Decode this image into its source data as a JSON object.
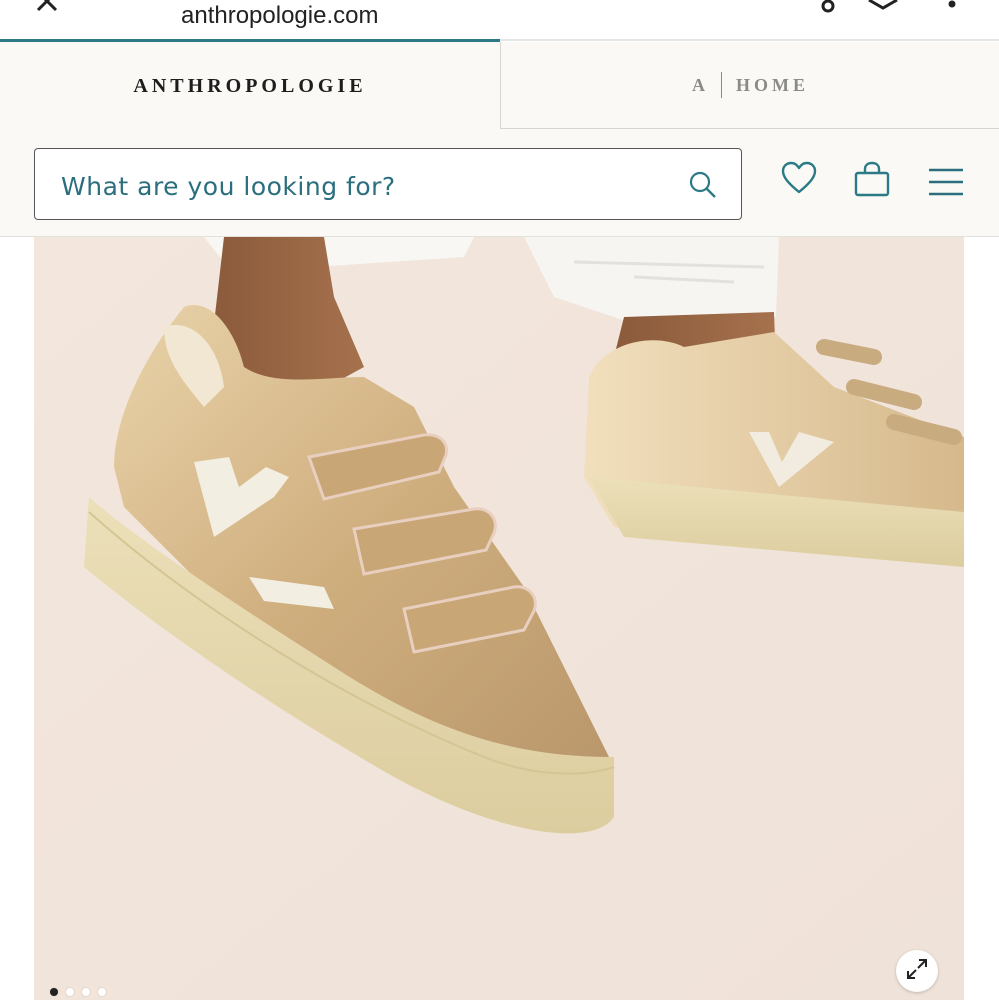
{
  "browser": {
    "url": "anthropologie.com",
    "load_progress": 0.5
  },
  "brand_tabs": {
    "primary": "ANTHROPOLOGIE",
    "secondary_mark": "A",
    "secondary_label": "HOME"
  },
  "search": {
    "placeholder": "What are you looking for?"
  },
  "header_icons": [
    "search-icon",
    "heart-icon",
    "bag-icon",
    "menu-icon"
  ],
  "colors": {
    "accent": "#2b7a86",
    "search_text": "#2b6f7e",
    "background": "#faf9f5"
  },
  "carousel": {
    "total_images": 4,
    "active_index": 0
  }
}
